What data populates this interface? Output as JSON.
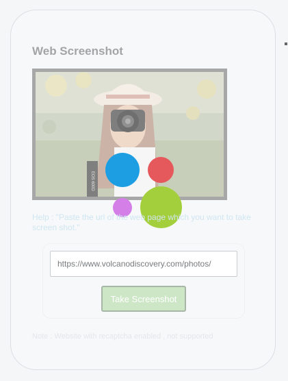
{
  "card": {
    "title": "Web Screenshot"
  },
  "photo": {
    "icon": "photo-of-photographer-with-camera",
    "camera_strap_text": "EOS 600D"
  },
  "help_text": "Help : \"Paste the url of the web page which you want to take screen shot.\"",
  "form": {
    "url_value": "https://www.volcanodiscovery.com/photos/",
    "button_label": "Take Screenshot"
  },
  "note": "Note : Website with recaptcha enabled , not supported",
  "colors": {
    "dot_blue": "#1d9ee3",
    "dot_red": "#e5595c",
    "dot_purple": "#d37fe7",
    "dot_green": "#a4cf3c",
    "button_bg": "#cde7c6"
  }
}
